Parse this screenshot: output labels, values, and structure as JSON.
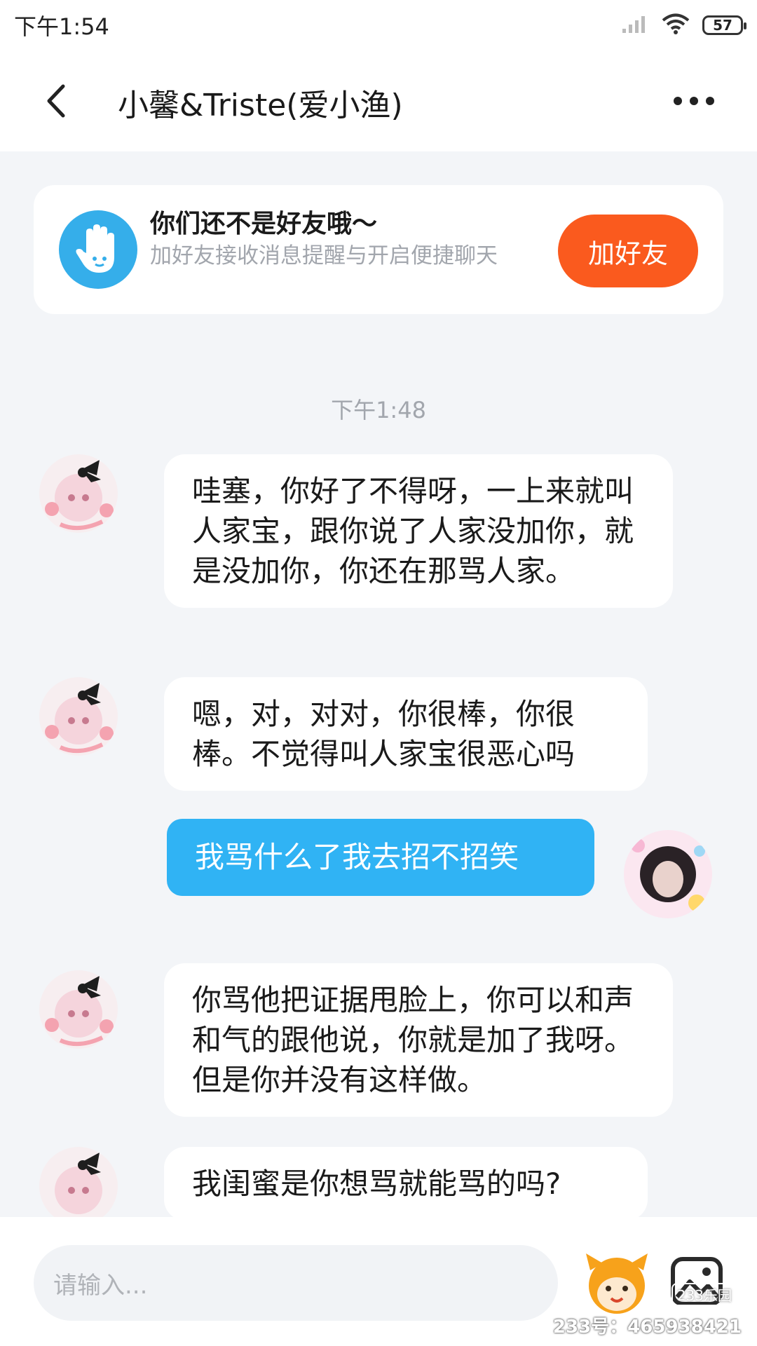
{
  "status": {
    "time": "下午1:54",
    "battery": "57"
  },
  "header": {
    "title": "小馨&Triste(爱小渔)"
  },
  "friend_card": {
    "title": "你们还不是好友哦～",
    "subtitle": "加好友接收消息提醒与开启便捷聊天",
    "button": "加好友"
  },
  "chat": {
    "time_separator": "下午1:48",
    "messages": [
      {
        "side": "in",
        "text": "哇塞，你好了不得呀，一上来就叫人家宝，跟你说了人家没加你，就是没加你，你还在那骂人家。"
      },
      {
        "side": "in",
        "text": "嗯，对，对对，你很棒，你很棒。不觉得叫人家宝很恶心吗"
      },
      {
        "side": "out",
        "text": "我骂什么了我去招不招笑"
      },
      {
        "side": "in",
        "text": "你骂他把证据甩脸上，你可以和声和气的跟他说，你就是加了我呀。但是你并没有这样做。"
      },
      {
        "side": "in",
        "text": "我闺蜜是你想骂就能骂的吗?"
      }
    ]
  },
  "input": {
    "placeholder": "请输入..."
  },
  "watermark": {
    "logo": "233乐园",
    "id": "233号：465938421"
  },
  "colors": {
    "accent_blue": "#30b3f4",
    "add_button": "#fa5a1e",
    "background": "#f3f5f8"
  },
  "icons": [
    "back-arrow-icon",
    "more-dots-icon",
    "wave-hand-icon",
    "emoji-mascot-icon",
    "image-picture-icon",
    "wifi-icon",
    "signal-icon",
    "battery-icon"
  ]
}
